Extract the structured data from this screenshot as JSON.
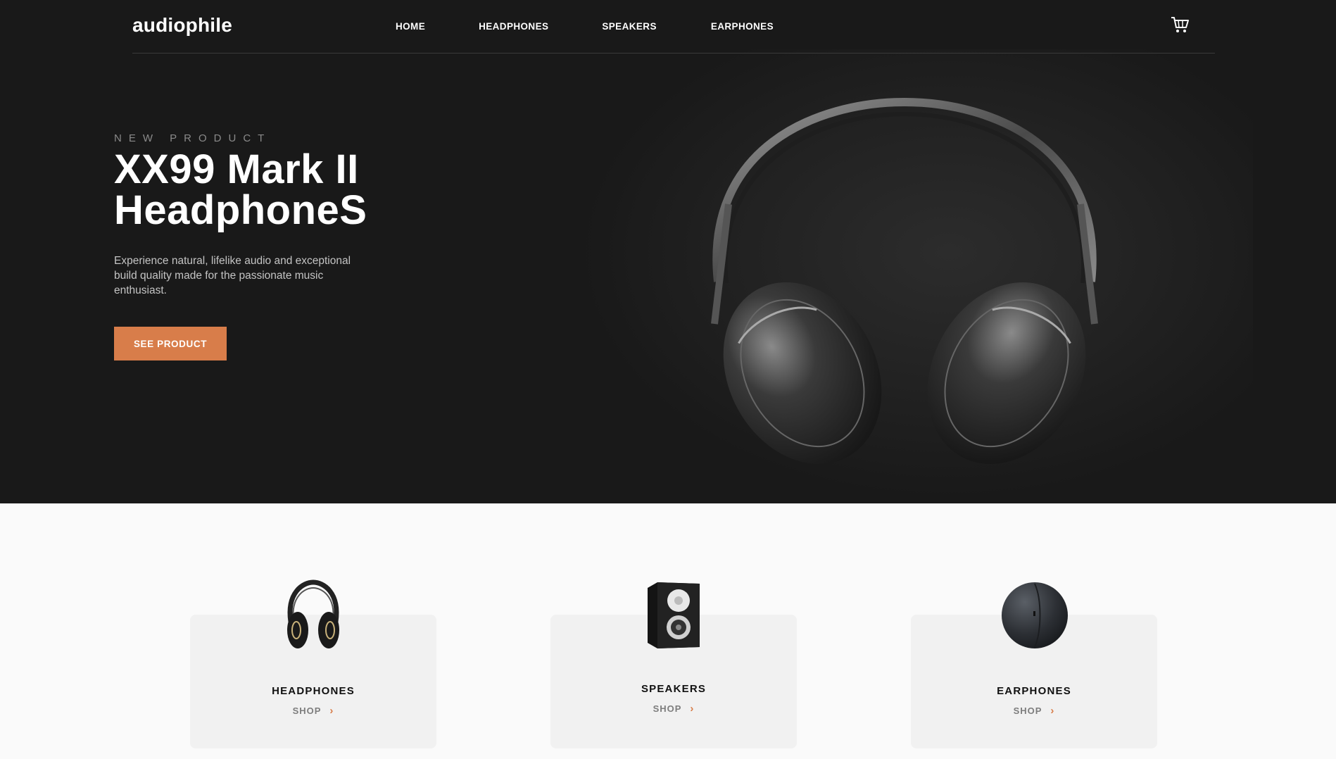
{
  "header": {
    "logo": "audiophile",
    "nav": [
      "HOME",
      "HEADPHONES",
      "SPEAKERS",
      "EARPHONES"
    ],
    "cart_icon": "cart-icon"
  },
  "hero": {
    "overline": "NEW PRODUCT",
    "title_line1": "XX99 Mark II",
    "title_line2": "HeadphoneS",
    "description": "Experience natural, lifelike audio and exceptional build quality made for the passionate music enthusiast.",
    "cta_label": "SEE PRODUCT",
    "image": "headphones-hero-image"
  },
  "categories": [
    {
      "name": "HEADPHONES",
      "shop": "SHOP",
      "icon": "headphones-thumbnail"
    },
    {
      "name": "SPEAKERS",
      "shop": "SHOP",
      "icon": "speaker-thumbnail"
    },
    {
      "name": "EARPHONES",
      "shop": "SHOP",
      "icon": "earphones-case-thumbnail"
    }
  ],
  "colors": {
    "accent": "#d87d4a",
    "dark": "#191919",
    "card": "#f1f1f1"
  }
}
